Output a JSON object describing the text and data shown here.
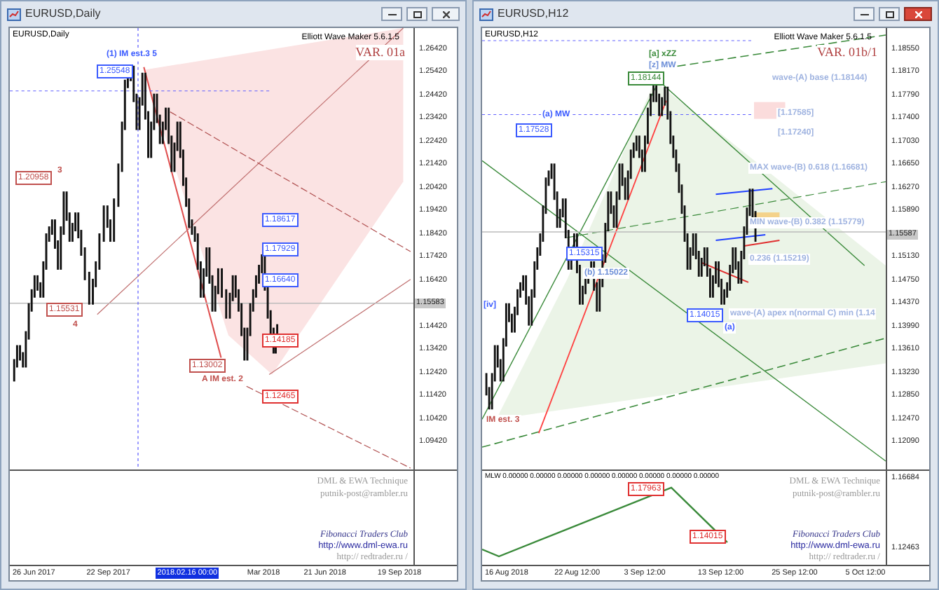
{
  "windows": [
    {
      "title": "EURUSD,Daily",
      "active": false,
      "chart_label": "EURUSD,Daily",
      "indicator": "Elliott Wave Maker 5.6.1.5",
      "variant": "VAR. 01a",
      "price_axis": [
        "1.26420",
        "1.25420",
        "1.24420",
        "1.23420",
        "1.22420",
        "1.21420",
        "1.20420",
        "1.19420",
        "1.18420",
        "1.17420",
        "1.16420",
        "1.14420",
        "1.13420",
        "1.12420",
        "1.11420",
        "1.10420",
        "1.09420"
      ],
      "current_price": "1.15583",
      "annotations": [
        {
          "text": "(1) IM est.3 5",
          "color": "#3b5bff",
          "kind": "label"
        },
        {
          "text": "1.25548",
          "color": "#3b5bff",
          "kind": "box"
        },
        {
          "text": "3",
          "color": "#c0504d",
          "kind": "label"
        },
        {
          "text": "1.20958",
          "color": "#c0504d",
          "kind": "box"
        },
        {
          "text": "1.15531",
          "color": "#c0504d",
          "kind": "box"
        },
        {
          "text": "4",
          "color": "#c0504d",
          "kind": "label"
        },
        {
          "text": "1.18617",
          "color": "#3b5bff",
          "kind": "box"
        },
        {
          "text": "1.17929",
          "color": "#3b5bff",
          "kind": "box"
        },
        {
          "text": "1.16640",
          "color": "#3b5bff",
          "kind": "box"
        },
        {
          "text": "1.14185",
          "color": "#e03030",
          "kind": "box"
        },
        {
          "text": "1.13002",
          "color": "#c0504d",
          "kind": "box"
        },
        {
          "text": "A IM est. 2",
          "color": "#c0504d",
          "kind": "label"
        },
        {
          "text": "1.12465",
          "color": "#e03030",
          "kind": "box"
        }
      ],
      "time_axis": [
        {
          "text": "26 Jun 2017",
          "selected": false
        },
        {
          "text": "22 Sep 2017",
          "selected": false
        },
        {
          "text": "2018.02.16 00:00",
          "selected": true
        },
        {
          "text": "Mar 2018",
          "selected": false
        },
        {
          "text": "21 Jun 2018",
          "selected": false
        },
        {
          "text": "19 Sep 2018",
          "selected": false
        }
      ],
      "credits": [
        "DML & EWA Technique",
        "putnik-post@rambler.ru"
      ],
      "links": [
        "Fibonacci Traders Club",
        "http://www.dml-ewa.ru",
        "http:// redtrader.ru /"
      ]
    },
    {
      "title": "EURUSD,H12",
      "active": true,
      "chart_label": "EURUSD,H12",
      "indicator": "Elliott Wave Maker 5.6.1.5",
      "variant": "VAR. 01b/1",
      "price_axis": [
        "1.18550",
        "1.18170",
        "1.17790",
        "1.17400",
        "1.17030",
        "1.16650",
        "1.16270",
        "1.15890",
        "1.15130",
        "1.14750",
        "1.14370",
        "1.13990",
        "1.13610",
        "1.13230",
        "1.12850",
        "1.12470",
        "1.12090"
      ],
      "current_price": "1.15587",
      "annotations": [
        {
          "text": "[a] xZZ",
          "color": "#3a8a3a",
          "kind": "label"
        },
        {
          "text": "[z] MW",
          "color": "#6d8fd8",
          "kind": "label"
        },
        {
          "text": "1.18144",
          "color": "#3a8a3a",
          "kind": "box"
        },
        {
          "text": "(a) MW",
          "color": "#3b5bff",
          "kind": "label"
        },
        {
          "text": "1.17528",
          "color": "#3b5bff",
          "kind": "box"
        },
        {
          "text": "wave-(A) base (1.18144)",
          "color": "#9fb3e0",
          "kind": "label"
        },
        {
          "text": "[1.17585]",
          "color": "#9fb3e0",
          "kind": "label"
        },
        {
          "text": "[1.17240]",
          "color": "#9fb3e0",
          "kind": "label"
        },
        {
          "text": "MAX wave-(B) 0.618 (1.16681)",
          "color": "#9fb3e0",
          "kind": "label"
        },
        {
          "text": "MIN wave-(B) 0.382 (1.15779)",
          "color": "#9fb3e0",
          "kind": "label"
        },
        {
          "text": "1.15315",
          "color": "#3b5bff",
          "kind": "box"
        },
        {
          "text": "0.236 (1.15219)",
          "color": "#9fb3e0",
          "kind": "label"
        },
        {
          "text": "(b) 1.15022",
          "color": "#6d8fd8",
          "kind": "label"
        },
        {
          "text": "[iv]",
          "color": "#3b5bff",
          "kind": "label"
        },
        {
          "text": "1.14015",
          "color": "#3b5bff",
          "kind": "box"
        },
        {
          "text": "wave-(A) apex n(normal C) min (1.14",
          "color": "#9fb3e0",
          "kind": "label"
        },
        {
          "text": "(a)",
          "color": "#3b5bff",
          "kind": "label"
        },
        {
          "text": "IM est. 3",
          "color": "#c0504d",
          "kind": "label"
        }
      ],
      "sub_label": "MLW 0.00000 0.00000 0.00000 0.00000 0.00000 0.00000 0.00000 0.00000",
      "sub_axis": [
        "1.16684",
        "1.12463"
      ],
      "sub_annotations": [
        {
          "text": "1.17963",
          "color": "#e03030",
          "kind": "box"
        },
        {
          "text": "1.14015",
          "color": "#e03030",
          "kind": "box"
        }
      ],
      "time_axis": [
        {
          "text": "16 Aug 2018",
          "selected": false
        },
        {
          "text": "22 Aug 12:00",
          "selected": false
        },
        {
          "text": "3 Sep 12:00",
          "selected": false
        },
        {
          "text": "13 Sep 12:00",
          "selected": false
        },
        {
          "text": "25 Sep 12:00",
          "selected": false
        },
        {
          "text": "5 Oct 12:00",
          "selected": false
        }
      ],
      "credits": [
        "DML & EWA Technique",
        "putnik-post@rambler.ru"
      ],
      "links": [
        "Fibonacci Traders Club",
        "http://www.dml-ewa.ru",
        "http:// redtrader.ru /"
      ]
    }
  ]
}
